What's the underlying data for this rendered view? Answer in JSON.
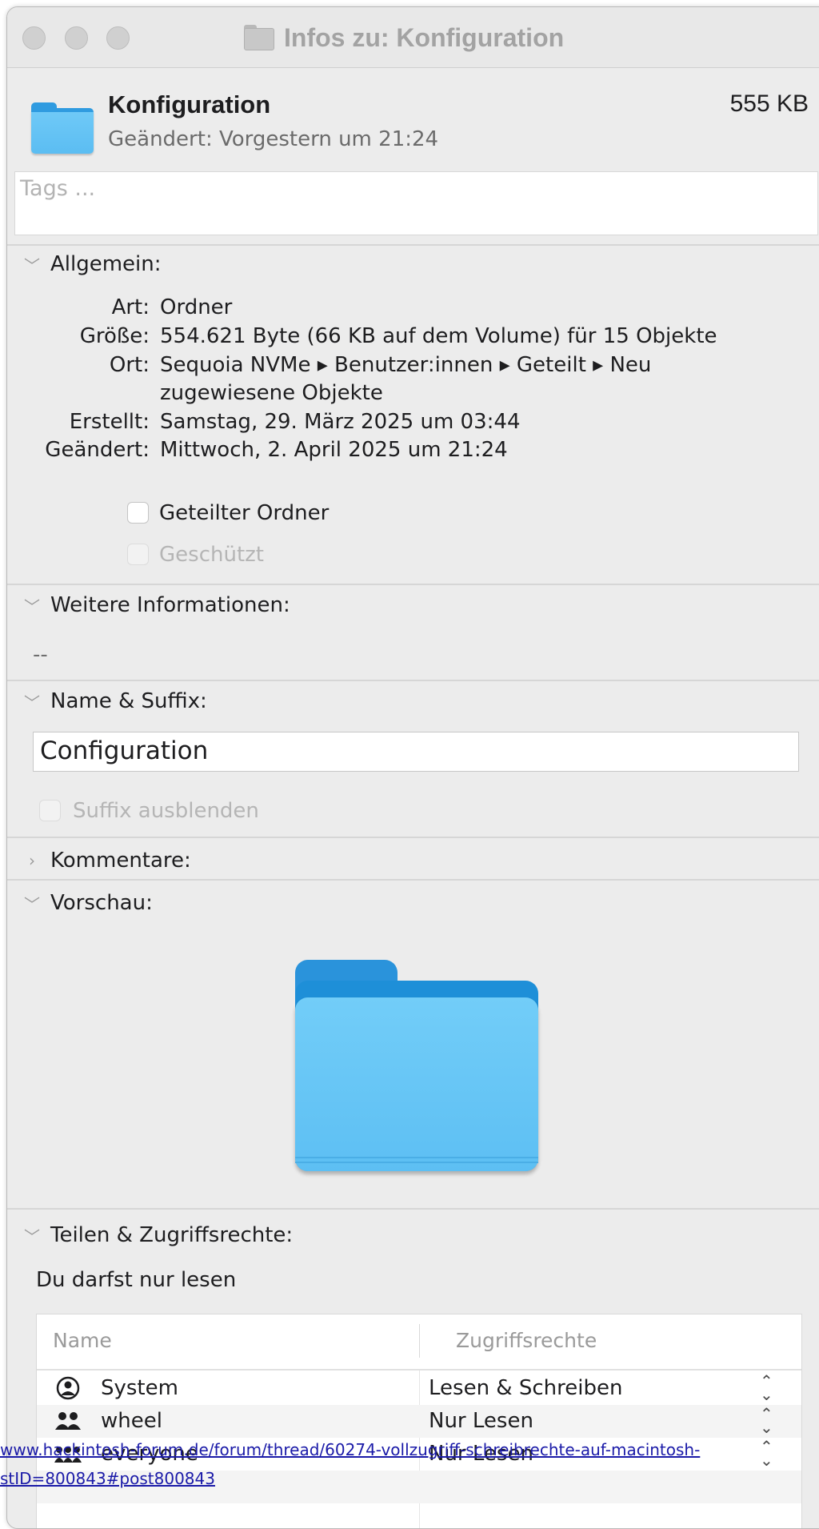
{
  "window": {
    "title": "Infos zu: Konfiguration"
  },
  "header": {
    "name": "Konfiguration",
    "modified": "Geändert: Vorgestern um 21:24",
    "size": "555 KB"
  },
  "tags": {
    "placeholder": "Tags ..."
  },
  "general": {
    "title": "Allgemein:",
    "rows": [
      {
        "key": "Art:",
        "value": "Ordner"
      },
      {
        "key": "Größe:",
        "value": "554.621 Byte (66 KB auf dem Volume) für 15 Objekte"
      },
      {
        "key": "Ort:",
        "value": "Sequoia NVMe ▸ Benutzer:innen ▸ Geteilt ▸ Neu",
        "value2": "zugewiesene Objekte"
      },
      {
        "key": "Erstellt:",
        "value": "Samstag, 29. März 2025 um 03:44"
      },
      {
        "key": "Geändert:",
        "value": "Mittwoch, 2. April 2025 um 21:24"
      }
    ],
    "shared_folder": {
      "label": "Geteilter Ordner",
      "checked": false
    },
    "locked": {
      "label": "Geschützt",
      "checked": false,
      "disabled": true
    }
  },
  "more_info": {
    "title": "Weitere Informationen:",
    "value": "--"
  },
  "name_suffix": {
    "title": "Name & Suffix:",
    "name_value": "Configuration",
    "hide_extension": {
      "label": "Suffix ausblenden",
      "checked": false,
      "disabled": true
    }
  },
  "comments": {
    "title": "Kommentare:"
  },
  "preview": {
    "title": "Vorschau:"
  },
  "sharing": {
    "title": "Teilen & Zugriffsrechte:",
    "status": "Du darfst nur lesen",
    "columns": {
      "name": "Name",
      "permission": "Zugriffsrechte"
    },
    "rows": [
      {
        "name": "System",
        "permission": "Lesen & Schreiben",
        "icon": "user-circle-icon"
      },
      {
        "name": "wheel",
        "permission": "Nur Lesen",
        "icon": "group-icon"
      },
      {
        "name": "everyone",
        "permission": "Nur Lesen",
        "icon": "everyone-icon"
      }
    ]
  },
  "status_bar": {
    "link_line1": "www.hackintosh-forum.de/forum/thread/60274-vollzugriff-schreibrechte-auf-macintosh-",
    "link_line2": "stID=800843#post800843"
  },
  "colors": {
    "folder_blue": "#5bbdf2",
    "window_bg": "#ececec",
    "link": "#1a1aa8"
  }
}
